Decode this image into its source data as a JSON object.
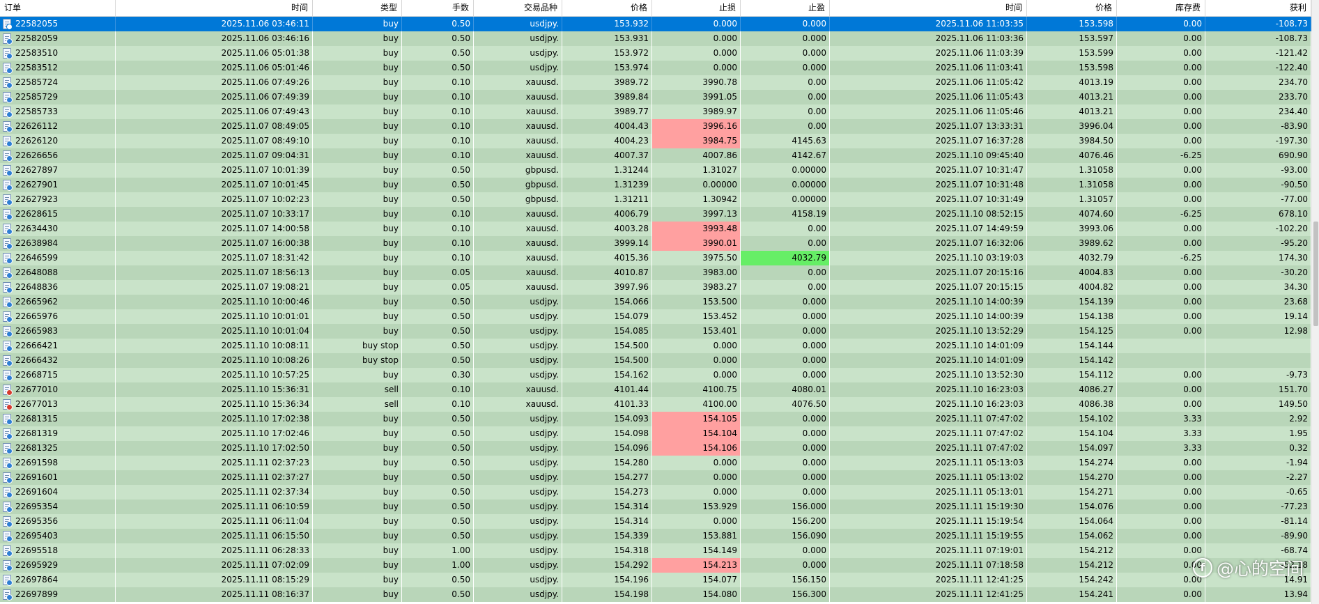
{
  "columns": [
    "订单",
    "时间",
    "类型",
    "手数",
    "交易品种",
    "价格",
    "止损",
    "止盈",
    "时间",
    "价格",
    "库存费",
    "获利"
  ],
  "sort_indicator": "/",
  "rows": [
    {
      "o": "22582055",
      "t": "2025.11.06 03:46:11",
      "ty": "buy",
      "lot": "0.50",
      "sym": "usdjpy.",
      "p": "153.932",
      "sl": "0.000",
      "tp": "0.000",
      "ct": "2025.11.06 11:03:35",
      "cp": "153.598",
      "sw": "0.00",
      "pr": "-108.73",
      "sel": true
    },
    {
      "o": "22582059",
      "t": "2025.11.06 03:46:16",
      "ty": "buy",
      "lot": "0.50",
      "sym": "usdjpy.",
      "p": "153.931",
      "sl": "0.000",
      "tp": "0.000",
      "ct": "2025.11.06 11:03:36",
      "cp": "153.597",
      "sw": "0.00",
      "pr": "-108.73"
    },
    {
      "o": "22583510",
      "t": "2025.11.06 05:01:38",
      "ty": "buy",
      "lot": "0.50",
      "sym": "usdjpy.",
      "p": "153.972",
      "sl": "0.000",
      "tp": "0.000",
      "ct": "2025.11.06 11:03:39",
      "cp": "153.599",
      "sw": "0.00",
      "pr": "-121.42"
    },
    {
      "o": "22583512",
      "t": "2025.11.06 05:01:46",
      "ty": "buy",
      "lot": "0.50",
      "sym": "usdjpy.",
      "p": "153.974",
      "sl": "0.000",
      "tp": "0.000",
      "ct": "2025.11.06 11:03:41",
      "cp": "153.598",
      "sw": "0.00",
      "pr": "-122.40"
    },
    {
      "o": "22585724",
      "t": "2025.11.06 07:49:26",
      "ty": "buy",
      "lot": "0.10",
      "sym": "xauusd.",
      "p": "3989.72",
      "sl": "3990.78",
      "tp": "0.00",
      "ct": "2025.11.06 11:05:42",
      "cp": "4013.19",
      "sw": "0.00",
      "pr": "234.70"
    },
    {
      "o": "22585729",
      "t": "2025.11.06 07:49:39",
      "ty": "buy",
      "lot": "0.10",
      "sym": "xauusd.",
      "p": "3989.84",
      "sl": "3991.05",
      "tp": "0.00",
      "ct": "2025.11.06 11:05:43",
      "cp": "4013.21",
      "sw": "0.00",
      "pr": "233.70"
    },
    {
      "o": "22585733",
      "t": "2025.11.06 07:49:43",
      "ty": "buy",
      "lot": "0.10",
      "sym": "xauusd.",
      "p": "3989.77",
      "sl": "3989.97",
      "tp": "0.00",
      "ct": "2025.11.06 11:05:46",
      "cp": "4013.21",
      "sw": "0.00",
      "pr": "234.40"
    },
    {
      "o": "22626112",
      "t": "2025.11.07 08:49:05",
      "ty": "buy",
      "lot": "0.10",
      "sym": "xauusd.",
      "p": "4004.43",
      "sl": "3996.16",
      "tp": "0.00",
      "ct": "2025.11.07 13:33:31",
      "cp": "3996.04",
      "sw": "0.00",
      "pr": "-83.90",
      "slc": "red"
    },
    {
      "o": "22626120",
      "t": "2025.11.07 08:49:10",
      "ty": "buy",
      "lot": "0.10",
      "sym": "xauusd.",
      "p": "4004.23",
      "sl": "3984.75",
      "tp": "4145.63",
      "ct": "2025.11.07 16:37:28",
      "cp": "3984.50",
      "sw": "0.00",
      "pr": "-197.30",
      "slc": "red"
    },
    {
      "o": "22626656",
      "t": "2025.11.07 09:04:31",
      "ty": "buy",
      "lot": "0.10",
      "sym": "xauusd.",
      "p": "4007.37",
      "sl": "4007.86",
      "tp": "4142.67",
      "ct": "2025.11.10 09:45:40",
      "cp": "4076.46",
      "sw": "-6.25",
      "pr": "690.90"
    },
    {
      "o": "22627897",
      "t": "2025.11.07 10:01:39",
      "ty": "buy",
      "lot": "0.50",
      "sym": "gbpusd.",
      "p": "1.31244",
      "sl": "1.31027",
      "tp": "0.00000",
      "ct": "2025.11.07 10:31:47",
      "cp": "1.31058",
      "sw": "0.00",
      "pr": "-93.00"
    },
    {
      "o": "22627901",
      "t": "2025.11.07 10:01:45",
      "ty": "buy",
      "lot": "0.50",
      "sym": "gbpusd.",
      "p": "1.31239",
      "sl": "0.00000",
      "tp": "0.00000",
      "ct": "2025.11.07 10:31:48",
      "cp": "1.31058",
      "sw": "0.00",
      "pr": "-90.50"
    },
    {
      "o": "22627923",
      "t": "2025.11.07 10:02:23",
      "ty": "buy",
      "lot": "0.50",
      "sym": "gbpusd.",
      "p": "1.31211",
      "sl": "1.30942",
      "tp": "0.00000",
      "ct": "2025.11.07 10:31:49",
      "cp": "1.31057",
      "sw": "0.00",
      "pr": "-77.00"
    },
    {
      "o": "22628615",
      "t": "2025.11.07 10:33:17",
      "ty": "buy",
      "lot": "0.10",
      "sym": "xauusd.",
      "p": "4006.79",
      "sl": "3997.13",
      "tp": "4158.19",
      "ct": "2025.11.10 08:52:15",
      "cp": "4074.60",
      "sw": "-6.25",
      "pr": "678.10"
    },
    {
      "o": "22634430",
      "t": "2025.11.07 14:00:58",
      "ty": "buy",
      "lot": "0.10",
      "sym": "xauusd.",
      "p": "4003.28",
      "sl": "3993.48",
      "tp": "0.00",
      "ct": "2025.11.07 14:49:59",
      "cp": "3993.06",
      "sw": "0.00",
      "pr": "-102.20",
      "slc": "red"
    },
    {
      "o": "22638984",
      "t": "2025.11.07 16:00:38",
      "ty": "buy",
      "lot": "0.10",
      "sym": "xauusd.",
      "p": "3999.14",
      "sl": "3990.01",
      "tp": "0.00",
      "ct": "2025.11.07 16:32:06",
      "cp": "3989.62",
      "sw": "0.00",
      "pr": "-95.20",
      "slc": "red"
    },
    {
      "o": "22646599",
      "t": "2025.11.07 18:31:42",
      "ty": "buy",
      "lot": "0.10",
      "sym": "xauusd.",
      "p": "4015.36",
      "sl": "3975.50",
      "tp": "4032.79",
      "ct": "2025.11.10 03:19:03",
      "cp": "4032.79",
      "sw": "-6.25",
      "pr": "174.30",
      "tpc": "green"
    },
    {
      "o": "22648088",
      "t": "2025.11.07 18:56:13",
      "ty": "buy",
      "lot": "0.05",
      "sym": "xauusd.",
      "p": "4010.87",
      "sl": "3983.00",
      "tp": "0.00",
      "ct": "2025.11.07 20:15:16",
      "cp": "4004.83",
      "sw": "0.00",
      "pr": "-30.20"
    },
    {
      "o": "22648836",
      "t": "2025.11.07 19:08:21",
      "ty": "buy",
      "lot": "0.05",
      "sym": "xauusd.",
      "p": "3997.96",
      "sl": "3983.27",
      "tp": "0.00",
      "ct": "2025.11.07 20:15:15",
      "cp": "4004.82",
      "sw": "0.00",
      "pr": "34.30"
    },
    {
      "o": "22665962",
      "t": "2025.11.10 10:00:46",
      "ty": "buy",
      "lot": "0.50",
      "sym": "usdjpy.",
      "p": "154.066",
      "sl": "153.500",
      "tp": "0.000",
      "ct": "2025.11.10 14:00:39",
      "cp": "154.139",
      "sw": "0.00",
      "pr": "23.68"
    },
    {
      "o": "22665976",
      "t": "2025.11.10 10:01:01",
      "ty": "buy",
      "lot": "0.50",
      "sym": "usdjpy.",
      "p": "154.079",
      "sl": "153.452",
      "tp": "0.000",
      "ct": "2025.11.10 14:00:39",
      "cp": "154.138",
      "sw": "0.00",
      "pr": "19.14"
    },
    {
      "o": "22665983",
      "t": "2025.11.10 10:01:04",
      "ty": "buy",
      "lot": "0.50",
      "sym": "usdjpy.",
      "p": "154.085",
      "sl": "153.401",
      "tp": "0.000",
      "ct": "2025.11.10 13:52:29",
      "cp": "154.125",
      "sw": "0.00",
      "pr": "12.98"
    },
    {
      "o": "22666421",
      "t": "2025.11.10 10:08:11",
      "ty": "buy stop",
      "lot": "0.50",
      "sym": "usdjpy.",
      "p": "154.500",
      "sl": "0.000",
      "tp": "0.000",
      "ct": "2025.11.10 14:01:09",
      "cp": "154.144",
      "sw": "",
      "pr": ""
    },
    {
      "o": "22666432",
      "t": "2025.11.10 10:08:26",
      "ty": "buy stop",
      "lot": "0.50",
      "sym": "usdjpy.",
      "p": "154.500",
      "sl": "0.000",
      "tp": "0.000",
      "ct": "2025.11.10 14:01:09",
      "cp": "154.142",
      "sw": "",
      "pr": ""
    },
    {
      "o": "22668715",
      "t": "2025.11.10 10:57:25",
      "ty": "buy",
      "lot": "0.30",
      "sym": "usdjpy.",
      "p": "154.162",
      "sl": "0.000",
      "tp": "0.000",
      "ct": "2025.11.10 13:52:30",
      "cp": "154.112",
      "sw": "0.00",
      "pr": "-9.73"
    },
    {
      "o": "22677010",
      "t": "2025.11.10 15:36:31",
      "ty": "sell",
      "lot": "0.10",
      "sym": "xauusd.",
      "p": "4101.44",
      "sl": "4100.75",
      "tp": "4080.01",
      "ct": "2025.11.10 16:23:03",
      "cp": "4086.27",
      "sw": "0.00",
      "pr": "151.70",
      "sell": true
    },
    {
      "o": "22677013",
      "t": "2025.11.10 15:36:34",
      "ty": "sell",
      "lot": "0.10",
      "sym": "xauusd.",
      "p": "4101.33",
      "sl": "4100.00",
      "tp": "4076.50",
      "ct": "2025.11.10 16:23:03",
      "cp": "4086.38",
      "sw": "0.00",
      "pr": "149.50",
      "sell": true
    },
    {
      "o": "22681315",
      "t": "2025.11.10 17:02:38",
      "ty": "buy",
      "lot": "0.50",
      "sym": "usdjpy.",
      "p": "154.093",
      "sl": "154.105",
      "tp": "0.000",
      "ct": "2025.11.11 07:47:02",
      "cp": "154.102",
      "sw": "3.33",
      "pr": "2.92",
      "slc": "red"
    },
    {
      "o": "22681319",
      "t": "2025.11.10 17:02:46",
      "ty": "buy",
      "lot": "0.50",
      "sym": "usdjpy.",
      "p": "154.098",
      "sl": "154.104",
      "tp": "0.000",
      "ct": "2025.11.11 07:47:02",
      "cp": "154.104",
      "sw": "3.33",
      "pr": "1.95",
      "slc": "red"
    },
    {
      "o": "22681325",
      "t": "2025.11.10 17:02:50",
      "ty": "buy",
      "lot": "0.50",
      "sym": "usdjpy.",
      "p": "154.096",
      "sl": "154.106",
      "tp": "0.000",
      "ct": "2025.11.11 07:47:02",
      "cp": "154.097",
      "sw": "3.33",
      "pr": "0.32",
      "slc": "red"
    },
    {
      "o": "22691598",
      "t": "2025.11.11 02:37:23",
      "ty": "buy",
      "lot": "0.50",
      "sym": "usdjpy.",
      "p": "154.280",
      "sl": "0.000",
      "tp": "0.000",
      "ct": "2025.11.11 05:13:03",
      "cp": "154.274",
      "sw": "0.00",
      "pr": "-1.94"
    },
    {
      "o": "22691601",
      "t": "2025.11.11 02:37:27",
      "ty": "buy",
      "lot": "0.50",
      "sym": "usdjpy.",
      "p": "154.277",
      "sl": "0.000",
      "tp": "0.000",
      "ct": "2025.11.11 05:13:02",
      "cp": "154.270",
      "sw": "0.00",
      "pr": "-2.27"
    },
    {
      "o": "22691604",
      "t": "2025.11.11 02:37:34",
      "ty": "buy",
      "lot": "0.50",
      "sym": "usdjpy.",
      "p": "154.273",
      "sl": "0.000",
      "tp": "0.000",
      "ct": "2025.11.11 05:13:01",
      "cp": "154.271",
      "sw": "0.00",
      "pr": "-0.65"
    },
    {
      "o": "22695354",
      "t": "2025.11.11 06:10:59",
      "ty": "buy",
      "lot": "0.50",
      "sym": "usdjpy.",
      "p": "154.314",
      "sl": "153.929",
      "tp": "156.000",
      "ct": "2025.11.11 15:19:30",
      "cp": "154.076",
      "sw": "0.00",
      "pr": "-77.23"
    },
    {
      "o": "22695356",
      "t": "2025.11.11 06:11:04",
      "ty": "buy",
      "lot": "0.50",
      "sym": "usdjpy.",
      "p": "154.314",
      "sl": "0.000",
      "tp": "156.200",
      "ct": "2025.11.11 15:19:54",
      "cp": "154.064",
      "sw": "0.00",
      "pr": "-81.14"
    },
    {
      "o": "22695403",
      "t": "2025.11.11 06:15:50",
      "ty": "buy",
      "lot": "0.50",
      "sym": "usdjpy.",
      "p": "154.339",
      "sl": "153.881",
      "tp": "156.090",
      "ct": "2025.11.11 15:19:55",
      "cp": "154.062",
      "sw": "0.00",
      "pr": "-89.90"
    },
    {
      "o": "22695518",
      "t": "2025.11.11 06:28:33",
      "ty": "buy",
      "lot": "1.00",
      "sym": "usdjpy.",
      "p": "154.318",
      "sl": "154.149",
      "tp": "0.000",
      "ct": "2025.11.11 07:19:01",
      "cp": "154.212",
      "sw": "0.00",
      "pr": "-68.74"
    },
    {
      "o": "22695929",
      "t": "2025.11.11 07:02:09",
      "ty": "buy",
      "lot": "1.00",
      "sym": "usdjpy.",
      "p": "154.292",
      "sl": "154.213",
      "tp": "0.000",
      "ct": "2025.11.11 07:18:58",
      "cp": "154.212",
      "sw": "0.00",
      "pr": "-52.18",
      "slc": "red"
    },
    {
      "o": "22697864",
      "t": "2025.11.11 08:15:29",
      "ty": "buy",
      "lot": "0.50",
      "sym": "usdjpy.",
      "p": "154.196",
      "sl": "154.077",
      "tp": "156.150",
      "ct": "2025.11.11 12:41:25",
      "cp": "154.242",
      "sw": "0.00",
      "pr": "14.91"
    },
    {
      "o": "22697899",
      "t": "2025.11.11 08:16:37",
      "ty": "buy",
      "lot": "0.50",
      "sym": "usdjpy.",
      "p": "154.198",
      "sl": "154.080",
      "tp": "156.300",
      "ct": "2025.11.11 12:41:25",
      "cp": "154.241",
      "sw": "0.00",
      "pr": "13.94"
    }
  ],
  "watermark": "@心的空间",
  "colors": {
    "row_even": "#c9e3c9",
    "row_odd": "#b9d6b9",
    "selected": "#0078d7",
    "stop_loss_hit": "#ffa0a0",
    "take_profit_hit": "#66ee66"
  }
}
